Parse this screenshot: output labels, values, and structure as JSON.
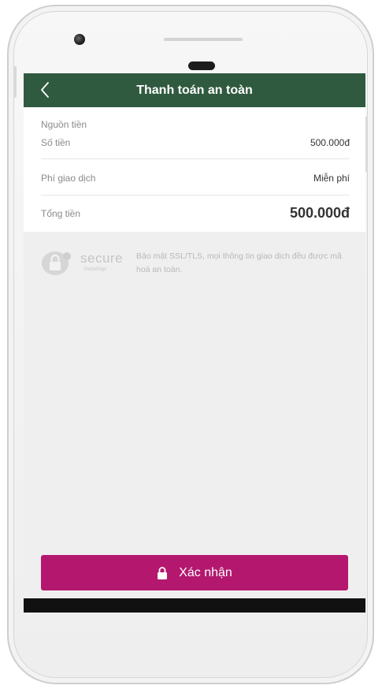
{
  "header": {
    "title": "Thanh toán an toàn",
    "back_icon": "chevron-left-icon"
  },
  "summary": {
    "source_label": "Nguồn tiền",
    "amount_label": "Số tiền",
    "amount_value": "500.000đ",
    "fee_label": "Phí giao dịch",
    "fee_value": "Miễn phí",
    "total_label": "Tổng tiền",
    "total_value": "500.000đ"
  },
  "security": {
    "badge_word": "secure",
    "badge_sub": "GlobalSign",
    "message": "Bảo mật SSL/TLS, mọi thông tin giao dịch đều được mã hoá an toàn."
  },
  "actions": {
    "confirm_label": "Xác nhận",
    "confirm_icon": "lock-icon"
  },
  "colors": {
    "header_bg": "#2f5a3f",
    "confirm_bg": "#b3186e",
    "screen_bg": "#efefef"
  }
}
